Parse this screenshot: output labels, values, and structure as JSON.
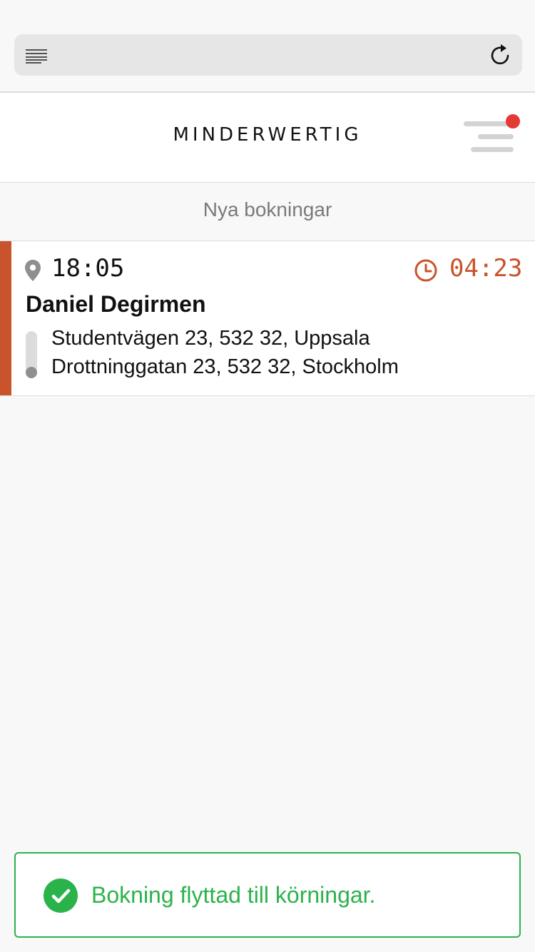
{
  "browser": {
    "reader_icon": "reader-lines-icon",
    "reload_icon": "reload-icon"
  },
  "header": {
    "brand": "MINDERWERTIG",
    "menu_icon": "hamburger-menu-icon",
    "notification_color": "#e53935"
  },
  "section": {
    "title": "Nya bokningar"
  },
  "bookings": [
    {
      "pickup_time": "18:05",
      "countdown": "04:23",
      "customer": "Daniel Degirmen",
      "from_address": "Studentvägen 23, 532 32, Uppsala",
      "to_address": "Drottninggatan 23, 532 32, Stockholm",
      "accent_color": "#c9532a"
    }
  ],
  "toast": {
    "message": "Bokning flyttad till körningar.",
    "icon": "check-circle-icon",
    "color": "#2bb34b"
  }
}
